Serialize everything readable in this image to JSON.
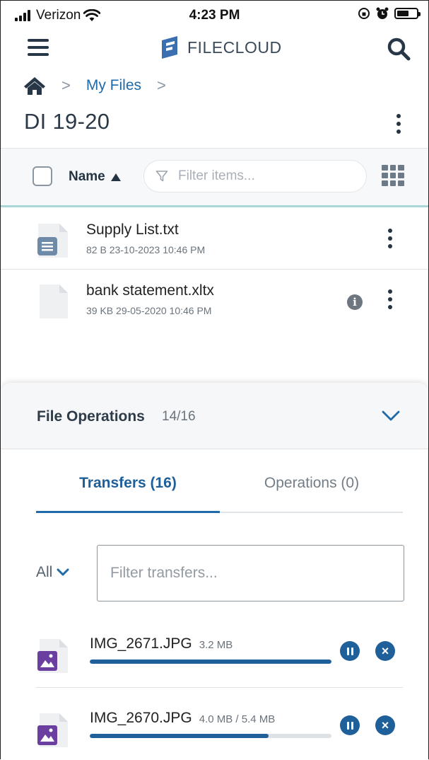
{
  "status_bar": {
    "carrier": "Verizon",
    "time": "4:23 PM"
  },
  "app": {
    "brand": "FILECLOUD",
    "brand_color": "#3b6fb0"
  },
  "breadcrumb": {
    "sep1": ">",
    "my_files": "My Files",
    "sep2": ">"
  },
  "folder": {
    "title": "DI 19-20"
  },
  "toolbar": {
    "sort_label": "Name",
    "filter_placeholder": "Filter items..."
  },
  "files": [
    {
      "name": "Supply List.txt",
      "meta": "82 B 23-10-2023 10:46 PM",
      "icon": "text-file-icon"
    },
    {
      "name": "bank statement.xltx",
      "meta": "39 KB 29-05-2020 10:46 PM",
      "icon": "blank-file-icon"
    }
  ],
  "operations_panel": {
    "title": "File Operations",
    "count": "14/16",
    "tabs": [
      {
        "label": "Transfers (16)",
        "active": true
      },
      {
        "label": "Operations (0)",
        "active": false
      }
    ],
    "all_label": "All",
    "filter_placeholder": "Filter transfers...",
    "transfers": [
      {
        "name": "IMG_2671.JPG",
        "size": "3.2 MB",
        "progress": 1.0
      },
      {
        "name": "IMG_2670.JPG",
        "size": "4.0 MB / 5.4 MB",
        "progress": 0.74
      }
    ]
  },
  "colors": {
    "accent": "#1f5f9a",
    "image_icon": "#6b3fa0",
    "toolbar_rule": "#a9d6d6"
  }
}
